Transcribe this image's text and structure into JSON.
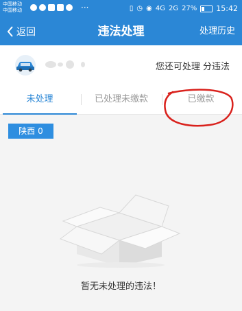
{
  "status_bar": {
    "carrier_line1": "中国移动",
    "carrier_line2": "中国移动",
    "signal_label_1": "4G",
    "signal_label_2": "2G",
    "battery": "27%",
    "battery_level": 0.27,
    "time": "15:42",
    "overflow": "···"
  },
  "nav": {
    "back_label": "返回",
    "title": "违法处理",
    "history_label": "处理历史"
  },
  "car_info": {
    "remaining_text": "您还可处理  分违法"
  },
  "tabs": [
    {
      "label": "未处理",
      "active": true
    },
    {
      "label": "已处理未缴款",
      "active": false
    },
    {
      "label": "已缴款",
      "active": false
    }
  ],
  "region": {
    "label": "陕西 0"
  },
  "empty_state": {
    "message": "暂无未处理的违法！"
  },
  "colors": {
    "primary": "#2b87d6",
    "annotation": "#d9211c"
  }
}
